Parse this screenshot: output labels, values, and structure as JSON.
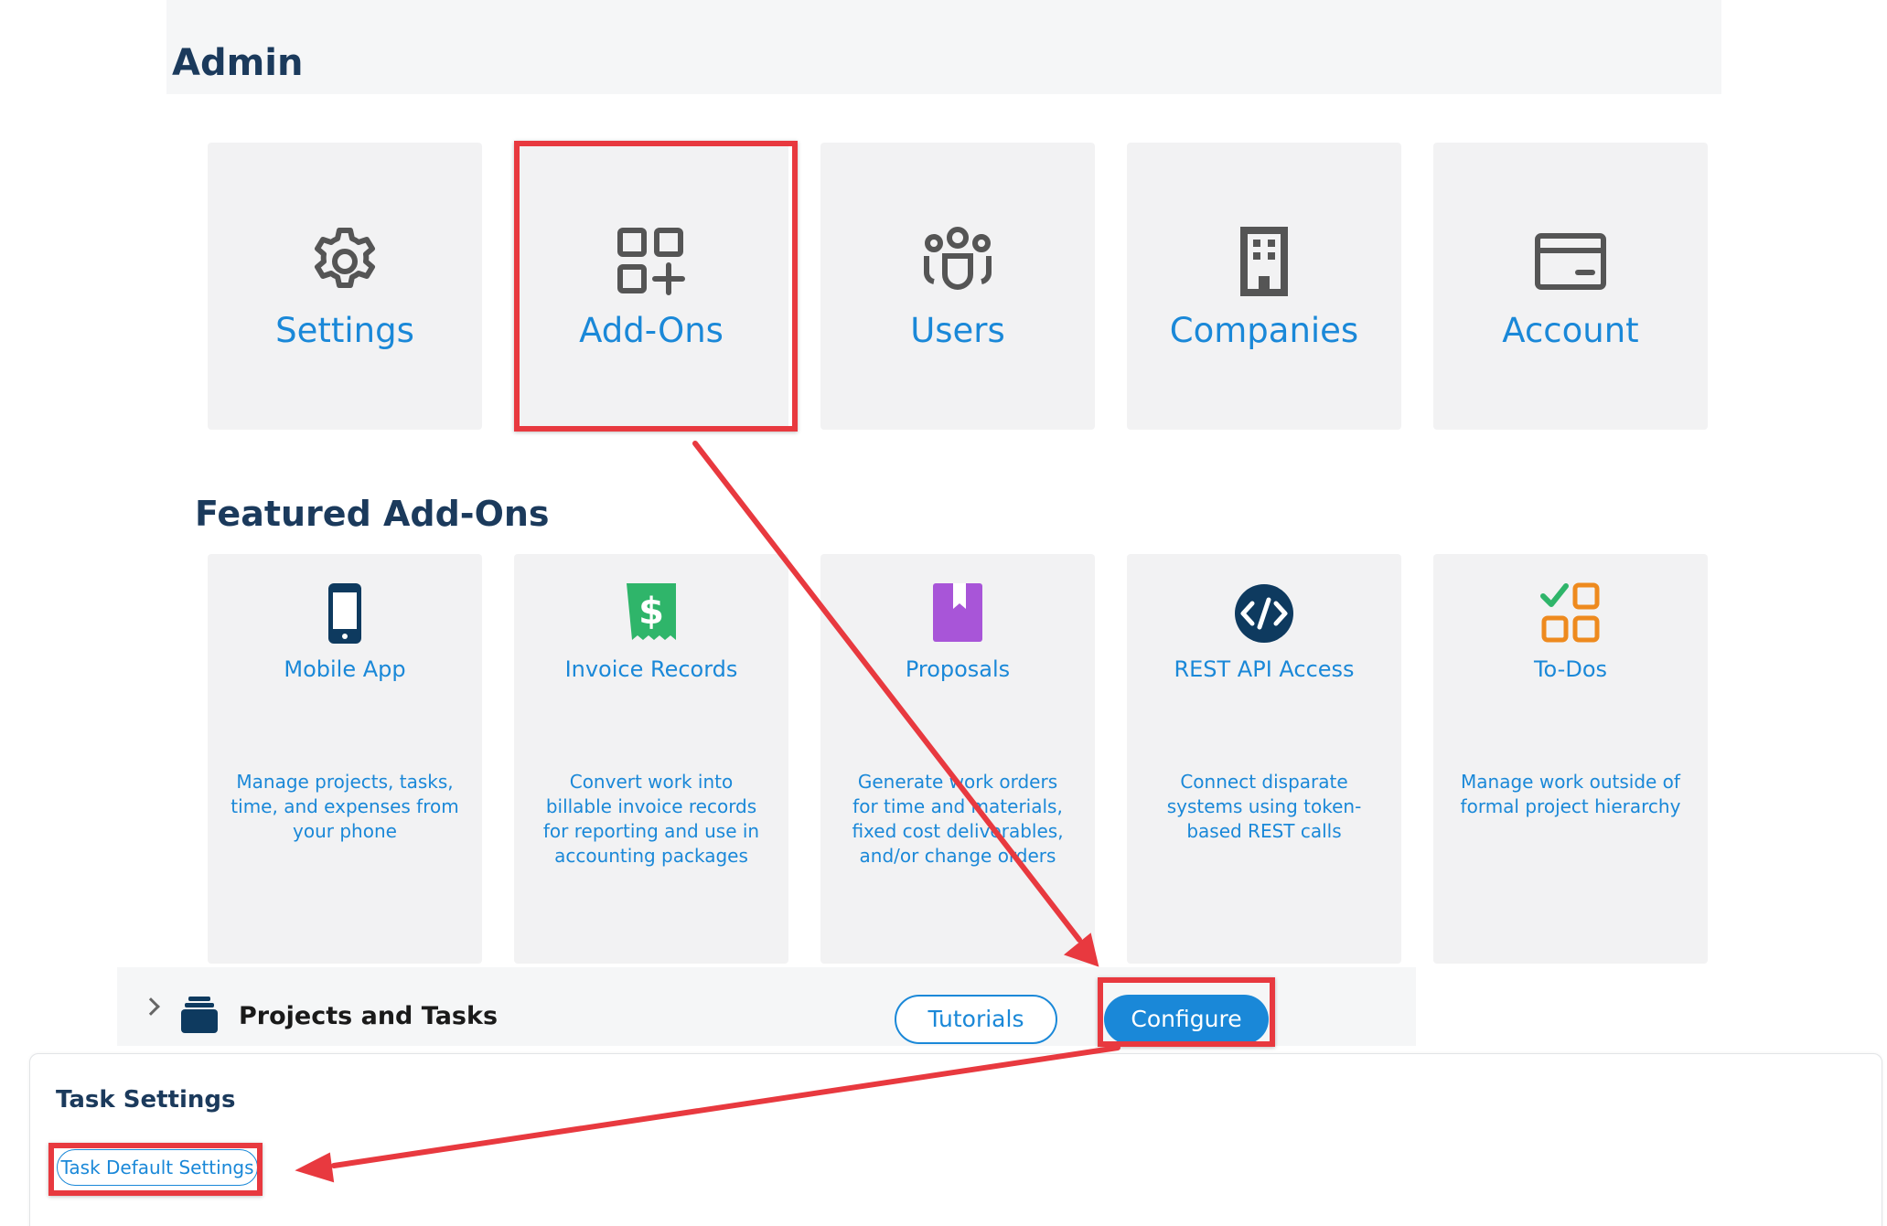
{
  "admin": {
    "title": "Admin"
  },
  "admin_tiles": [
    {
      "label": "Settings",
      "icon": "gear-icon"
    },
    {
      "label": "Add-Ons",
      "icon": "add-ons-icon"
    },
    {
      "label": "Users",
      "icon": "users-icon"
    },
    {
      "label": "Companies",
      "icon": "building-icon"
    },
    {
      "label": "Account",
      "icon": "credit-card-icon"
    }
  ],
  "featured": {
    "title": "Featured Add-Ons",
    "cards": [
      {
        "name": "Mobile App",
        "desc": "Manage projects, tasks, time, and expenses from your phone",
        "icon": "phone-icon",
        "color": "#0e3a5f"
      },
      {
        "name": "Invoice Records",
        "desc": "Convert work into billable invoice records for reporting and use in accounting packages",
        "icon": "dollar-receipt-icon",
        "color": "#2fb56a"
      },
      {
        "name": "Proposals",
        "desc": "Generate work orders for time and materials, fixed cost deliverables, and/or change orders",
        "icon": "book-icon",
        "color": "#a855d8"
      },
      {
        "name": "REST API Access",
        "desc": "Connect disparate systems using token-based REST calls",
        "icon": "code-icon",
        "color": "#0e3a5f"
      },
      {
        "name": "To-Dos",
        "desc": "Manage work outside of formal project hierarchy",
        "icon": "todo-icon",
        "color": "#ee8a1e"
      }
    ]
  },
  "projects": {
    "title": "Projects and Tasks",
    "tutorials_label": "Tutorials",
    "configure_label": "Configure"
  },
  "task_settings": {
    "title": "Task Settings",
    "default_label": "Task Default Settings"
  },
  "colors": {
    "accent": "#1a88d8",
    "highlight": "#e8393f",
    "heading": "#1b3a5c"
  }
}
